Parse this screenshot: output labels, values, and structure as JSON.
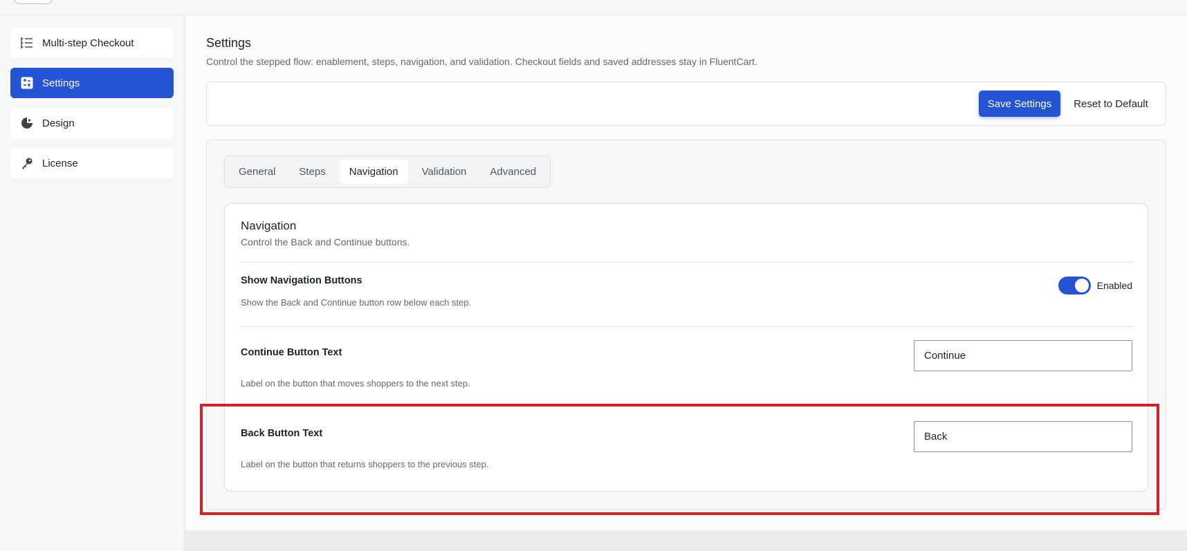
{
  "sidebar": {
    "items": [
      {
        "label": "Multi-step Checkout",
        "icon": "list-icon",
        "active": false
      },
      {
        "label": "Settings",
        "icon": "settings-panel-icon",
        "active": true
      },
      {
        "label": "Design",
        "icon": "palette-icon",
        "active": false
      },
      {
        "label": "License",
        "icon": "key-icon",
        "active": false
      }
    ]
  },
  "header": {
    "title": "Settings",
    "description": "Control the stepped flow: enablement, steps, navigation, and validation. Checkout fields and saved addresses stay in FluentCart."
  },
  "actions": {
    "save_label": "Save Settings",
    "reset_label": "Reset to Default"
  },
  "tabs": [
    {
      "label": "General",
      "active": false
    },
    {
      "label": "Steps",
      "active": false
    },
    {
      "label": "Navigation",
      "active": true
    },
    {
      "label": "Validation",
      "active": false
    },
    {
      "label": "Advanced",
      "active": false
    }
  ],
  "section": {
    "title": "Navigation",
    "description": "Control the Back and Continue buttons.",
    "fields": {
      "show_nav": {
        "label": "Show Navigation Buttons",
        "help": "Show the Back and Continue button row below each step.",
        "toggle_on": true,
        "toggle_text": "Enabled"
      },
      "continue_text": {
        "label": "Continue Button Text",
        "help": "Label on the button that moves shoppers to the next step.",
        "value": "Continue"
      },
      "back_text": {
        "label": "Back Button Text",
        "help": "Label on the button that returns shoppers to the previous step.",
        "value": "Back"
      }
    }
  },
  "colors": {
    "accent": "#2453d4",
    "highlight": "#d91f26"
  }
}
